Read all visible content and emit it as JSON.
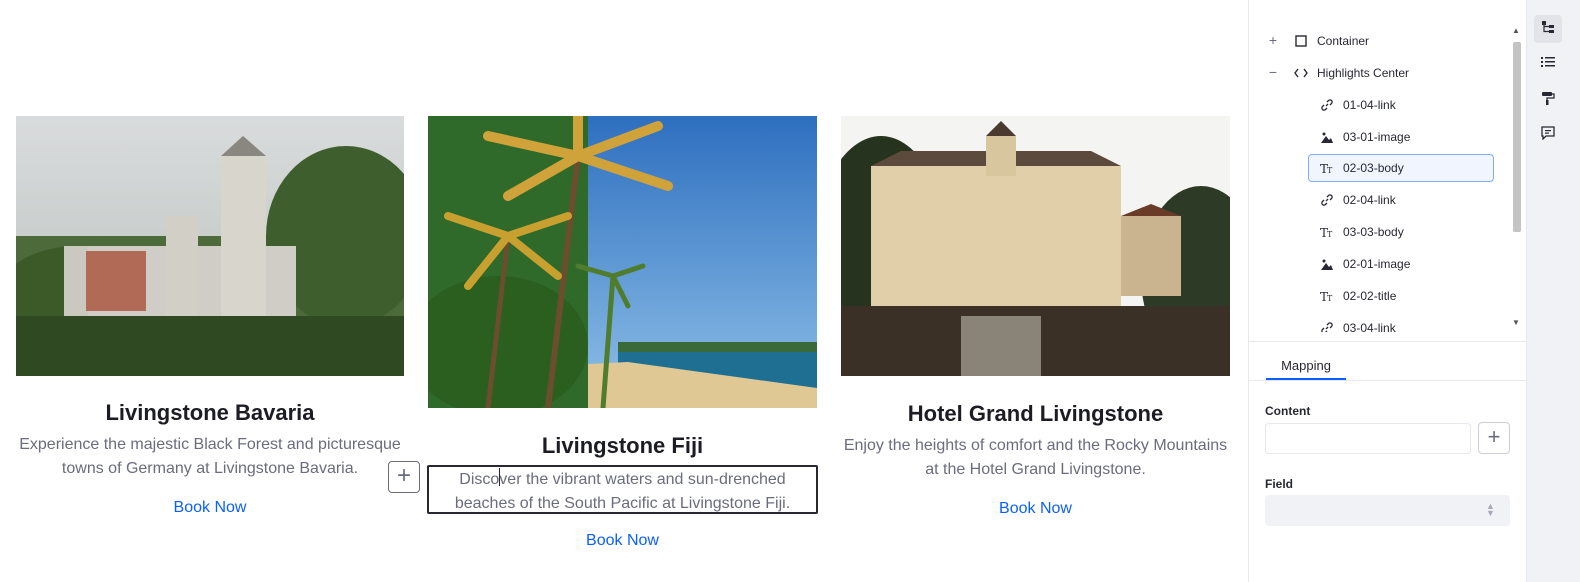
{
  "cards": [
    {
      "title": "Livingstone Bavaria",
      "body": "Experience the majestic Black Forest and picturesque towns of Germany at Livingstone Bavaria.",
      "link": "Book Now"
    },
    {
      "title": "Livingstone Fiji",
      "body": "Discover the vibrant waters and sun-drenched beaches of the South Pacific at Livingstone Fiji.",
      "link": "Book Now"
    },
    {
      "title": "Hotel Grand Livingstone",
      "body": "Enjoy the heights of comfort and the Rocky Mountains at the Hotel Grand Livingstone.",
      "link": "Book Now"
    }
  ],
  "add_button": "+",
  "tree": {
    "items": [
      {
        "label": "Container",
        "icon": "container-icon",
        "toggle": "+"
      },
      {
        "label": "Highlights Center",
        "icon": "code-icon",
        "toggle": "−"
      },
      {
        "label": "01-04-link",
        "icon": "link-icon"
      },
      {
        "label": "03-01-image",
        "icon": "image-icon"
      },
      {
        "label": "02-03-body",
        "icon": "text-icon",
        "selected": true
      },
      {
        "label": "02-04-link",
        "icon": "link-icon"
      },
      {
        "label": "03-03-body",
        "icon": "text-icon"
      },
      {
        "label": "02-01-image",
        "icon": "image-icon"
      },
      {
        "label": "02-02-title",
        "icon": "text-icon"
      },
      {
        "label": "03-04-link",
        "icon": "link-icon"
      }
    ]
  },
  "mapping": {
    "tab_label": "Mapping",
    "content_label": "Content",
    "content_value": "",
    "field_label": "Field",
    "field_value": ""
  },
  "colors": {
    "accent": "#0b5fff",
    "selection_border": "#80acff"
  }
}
